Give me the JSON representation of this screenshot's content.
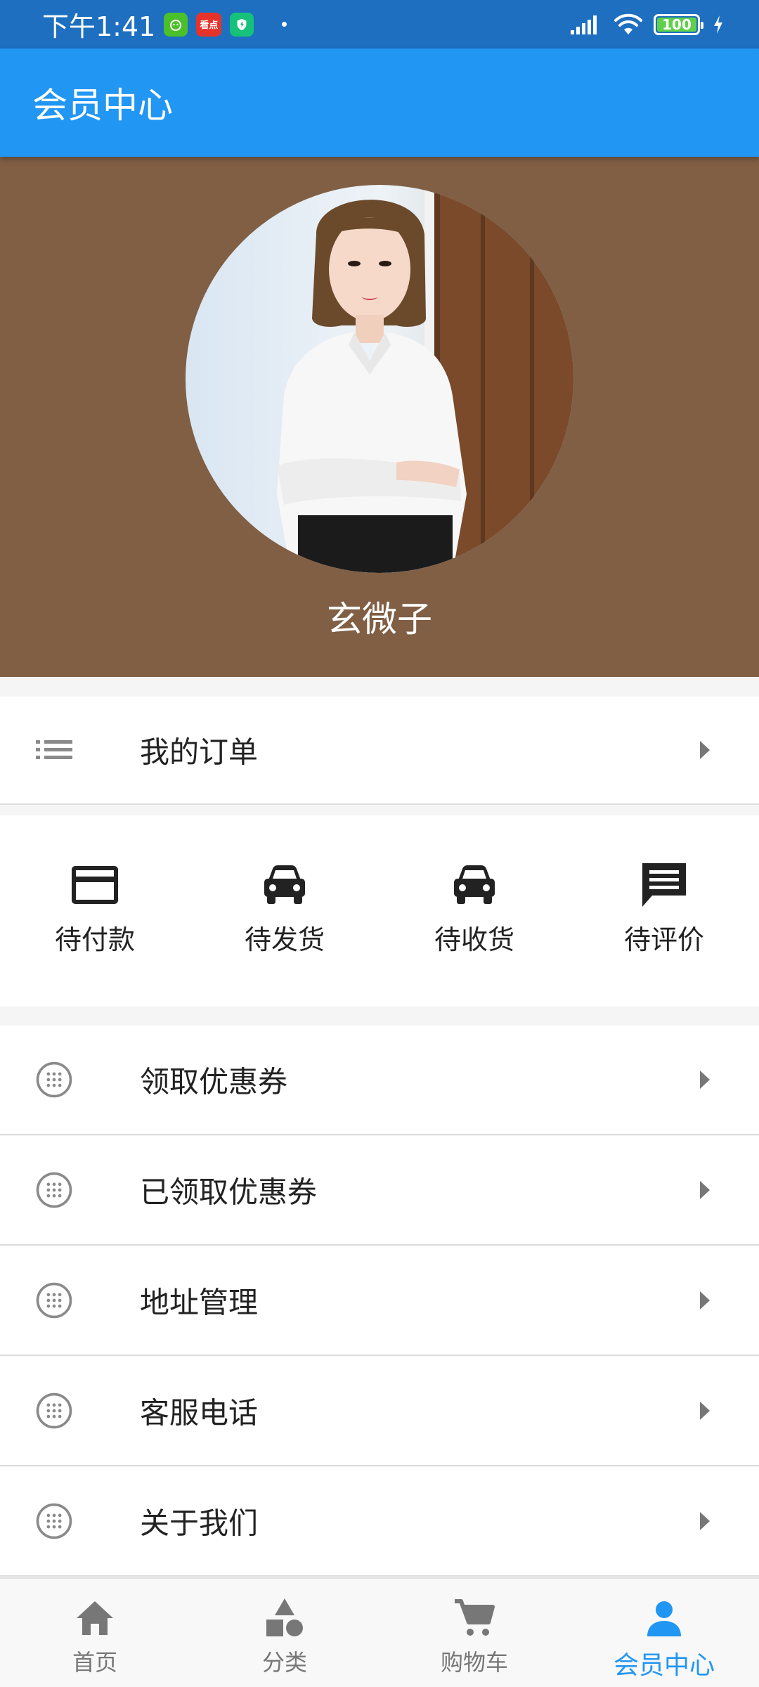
{
  "status_bar": {
    "time": "下午1:41",
    "app_badge_label": "看点",
    "battery": "100"
  },
  "app_bar": {
    "title": "会员中心"
  },
  "profile": {
    "username": "玄微子"
  },
  "orders": {
    "label": "我的订单"
  },
  "order_statuses": [
    {
      "label": "待付款",
      "icon": "credit-card-icon"
    },
    {
      "label": "待发货",
      "icon": "car-icon"
    },
    {
      "label": "待收货",
      "icon": "car-icon"
    },
    {
      "label": "待评价",
      "icon": "comment-icon"
    }
  ],
  "menu": [
    {
      "label": "领取优惠券"
    },
    {
      "label": "已领取优惠券"
    },
    {
      "label": "地址管理"
    },
    {
      "label": "客服电话"
    },
    {
      "label": "关于我们"
    }
  ],
  "bottom_nav": [
    {
      "label": "首页",
      "icon": "home-icon"
    },
    {
      "label": "分类",
      "icon": "category-icon"
    },
    {
      "label": "购物车",
      "icon": "cart-icon"
    },
    {
      "label": "会员中心",
      "icon": "person-icon",
      "active": true
    }
  ],
  "colors": {
    "primary": "#2196f3",
    "profile_bg": "#805f45",
    "status_bar": "#1e6fc0"
  }
}
